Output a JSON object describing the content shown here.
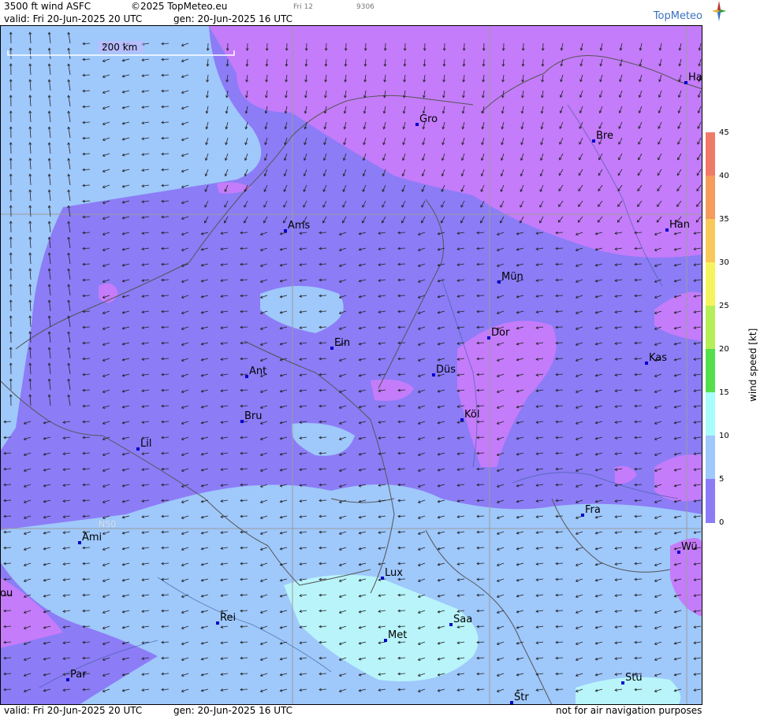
{
  "header": {
    "product": "3500 ft wind ASFC",
    "copyright": "©2025 TopMeteo.eu",
    "slot": "Fri 12",
    "code": "9306",
    "valid": "valid:  Fri  20-Jun-2025  20 UTC",
    "gen": "gen: 20-Jun-2025 16 UTC",
    "brand": "TopMeteo"
  },
  "footer": {
    "valid": "valid:  Fri  20-Jun-2025  20 UTC",
    "gen": "gen: 20-Jun-2025 16 UTC",
    "disclaimer": "not for air navigation purposes"
  },
  "map": {
    "scale_label": "200 km",
    "lat_label": "N50",
    "cities": [
      {
        "name": "Ha"
      },
      {
        "name": "Gro"
      },
      {
        "name": "Bre"
      },
      {
        "name": "Ams"
      },
      {
        "name": "Han"
      },
      {
        "name": "Mün"
      },
      {
        "name": "Dor"
      },
      {
        "name": "Ein"
      },
      {
        "name": "Kas"
      },
      {
        "name": "Ant"
      },
      {
        "name": "Düs"
      },
      {
        "name": "Bru"
      },
      {
        "name": "Köl"
      },
      {
        "name": "Lil"
      },
      {
        "name": "Fra"
      },
      {
        "name": "Ami"
      },
      {
        "name": "Wü"
      },
      {
        "name": "Lux"
      },
      {
        "name": "ou"
      },
      {
        "name": "Rei"
      },
      {
        "name": "Saa"
      },
      {
        "name": "Met"
      },
      {
        "name": "Par"
      },
      {
        "name": "Stu"
      },
      {
        "name": "Str"
      }
    ],
    "wind_direction": "from east / southeast (arrows pointing west)",
    "field_levels": {
      "northeast_kt": "0-5",
      "center_kt": "5-10",
      "southwest_kt": "10-15",
      "southeast_core_kt": "15-20"
    }
  },
  "colorbar": {
    "title": "wind  speed  [kt]",
    "ticks": [
      "45",
      "40",
      "35",
      "30",
      "25",
      "20",
      "15",
      "10",
      "5",
      "0"
    ],
    "colors": [
      "#f07a68",
      "#f59b5c",
      "#f8c95a",
      "#f6f45c",
      "#b6ee57",
      "#55e04b",
      "#a8fcfc",
      "#9fc8fb",
      "#8c7cf6",
      "#c47cfa"
    ]
  }
}
